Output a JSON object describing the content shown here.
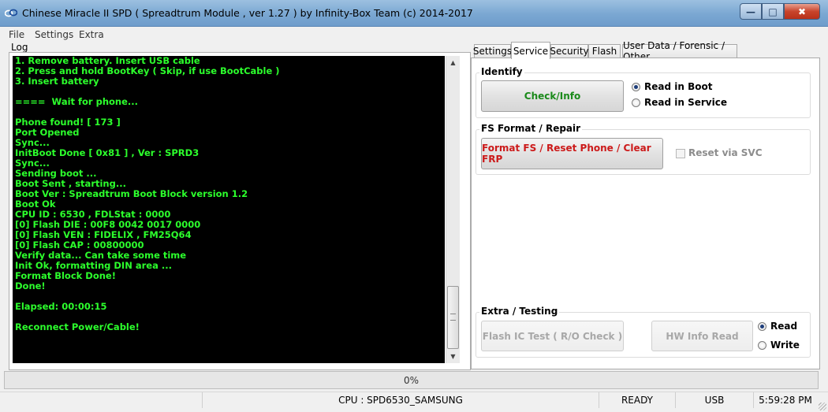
{
  "window": {
    "title": "Chinese Miracle II SPD ( Spreadtrum Module , ver 1.27 ) by Infinity-Box Team (c) 2014-2017",
    "minimize_glyph": "—",
    "maximize_glyph": "□",
    "close_glyph": "✖"
  },
  "menu": [
    "File",
    "Settings",
    "Extra"
  ],
  "log": {
    "label": "Log",
    "lines": [
      "1. Remove battery. Insert USB cable",
      "2. Press and hold BootKey ( Skip, if use BootCable )",
      "3. Insert battery",
      "",
      "====  Wait for phone...",
      "",
      "Phone found! [ 173 ]",
      "Port Opened",
      "Sync...",
      "InitBoot Done [ 0x81 ] , Ver : SPRD3",
      "Sync...",
      "Sending boot ...",
      "Boot Sent , starting...",
      "Boot Ver : Spreadtrum Boot Block version 1.2",
      "Boot Ok",
      "CPU ID : 6530 , FDLStat : 0000",
      "[0] Flash DIE : 00F8 0042 0017 0000",
      "[0] Flash VEN : FIDELIX , FM25Q64",
      "[0] Flash CAP : 00800000",
      "Verify data... Can take some time",
      "Init Ok, formatting DIN area ...",
      "Format Block Done!",
      "Done!",
      "",
      "Elapsed: 00:00:15",
      "",
      "Reconnect Power/Cable!"
    ],
    "text_color": "#2cff2c",
    "background_color": "#000000",
    "scroll_up_glyph": "▲",
    "scroll_down_glyph": "▼"
  },
  "tabs": [
    "Settings",
    "Service",
    "Security",
    "Flash",
    "User Data / Forensic / Other"
  ],
  "active_tab": "Service",
  "service": {
    "identify": {
      "title": "Identify",
      "button": "Check/Info",
      "button_color": "#1a8a1a",
      "options": [
        {
          "label": "Read in Boot",
          "checked": true
        },
        {
          "label": "Read in Service",
          "checked": false
        }
      ]
    },
    "fs_format": {
      "title": "FS Format / Repair",
      "button": "Format FS / Reset Phone / Clear FRP",
      "button_color": "#cc1a1a",
      "checkbox": {
        "label": "Reset via SVC",
        "checked": false,
        "enabled": false
      }
    },
    "extra": {
      "title": "Extra / Testing",
      "flash_button": "Flash IC Test ( R/O Check )",
      "hw_button": "HW Info Read",
      "options": [
        {
          "label": "Read",
          "checked": true
        },
        {
          "label": "Write",
          "checked": false
        }
      ]
    }
  },
  "progress": {
    "value": 0,
    "text": "0%"
  },
  "status": {
    "cpu": "CPU : SPD6530_SAMSUNG",
    "state": "READY",
    "port": "USB",
    "time": "5:59:28 PM"
  }
}
